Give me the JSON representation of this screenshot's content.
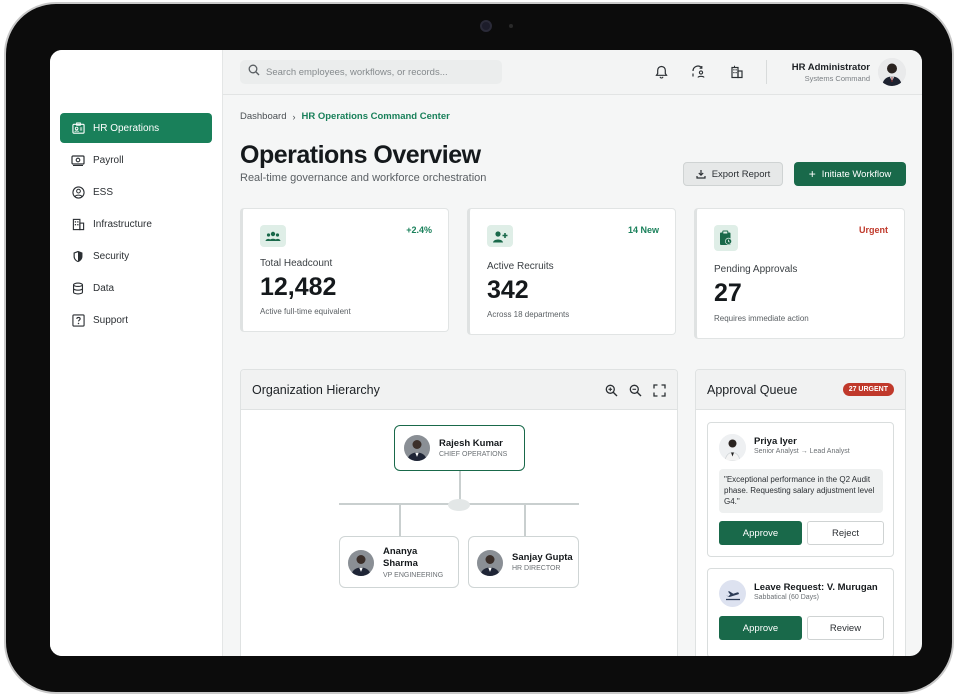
{
  "sidebar": {
    "items": [
      {
        "label": "HR Operations",
        "icon": "id-card-icon"
      },
      {
        "label": "Payroll",
        "icon": "banknote-icon"
      },
      {
        "label": "ESS",
        "icon": "user-circle-icon"
      },
      {
        "label": "Infrastructure",
        "icon": "building-icon"
      },
      {
        "label": "Security",
        "icon": "shield-icon"
      },
      {
        "label": "Data",
        "icon": "database-icon"
      },
      {
        "label": "Support",
        "icon": "help-icon"
      }
    ]
  },
  "topbar": {
    "search_placeholder": "Search employees, workflows, or records...",
    "user_name": "HR Administrator",
    "user_role": "Systems Command"
  },
  "breadcrumb": {
    "root": "Dashboard",
    "current": "HR Operations Command Center"
  },
  "header": {
    "title": "Operations Overview",
    "subtitle": "Real-time governance and workforce orchestration",
    "export_label": "Export Report",
    "initiate_label": "Initiate Workflow"
  },
  "stats": [
    {
      "label": "Total Headcount",
      "value": "12,482",
      "badge": "+2.4%",
      "foot": "Active full-time equivalent"
    },
    {
      "label": "Active Recruits",
      "value": "342",
      "badge": "14 New",
      "foot": "Across 18 departments"
    },
    {
      "label": "Pending Approvals",
      "value": "27",
      "badge": "Urgent",
      "foot": "Requires immediate action"
    }
  ],
  "org": {
    "title": "Organization Hierarchy",
    "root": {
      "name": "Rajesh Kumar",
      "role": "CHIEF OPERATIONS"
    },
    "children": [
      {
        "name": "Ananya Sharma",
        "role": "VP ENGINEERING"
      },
      {
        "name": "Sanjay Gupta",
        "role": "HR DIRECTOR"
      }
    ]
  },
  "queue": {
    "title": "Approval Queue",
    "badge": "27 URGENT",
    "items": [
      {
        "name": "Priya Iyer",
        "sub": "Senior Analyst → Lead Analyst",
        "quote": "\"Exceptional performance in the Q2 Audit phase. Requesting salary adjustment level G4.\"",
        "primary": "Approve",
        "secondary": "Reject"
      },
      {
        "name": "Leave Request: V. Murugan",
        "sub": "Sabbatical (60 Days)",
        "primary": "Approve",
        "secondary": "Review"
      }
    ]
  },
  "colors": {
    "accent": "#19805a",
    "accent_dark": "#19694a",
    "urgent": "#c0392b"
  }
}
